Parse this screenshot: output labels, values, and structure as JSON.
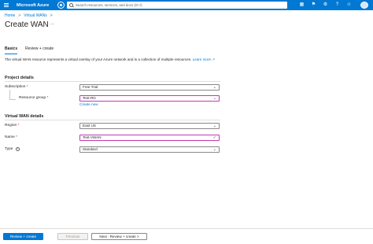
{
  "header": {
    "brand": "Microsoft Azure",
    "search_placeholder": "Search resources, services, and docs (G+/)",
    "icons": [
      "cloud-shell-icon",
      "notifications-icon",
      "settings-icon",
      "help-icon",
      "feedback-icon"
    ],
    "accent_color": "#0078d4"
  },
  "breadcrumb": {
    "items": [
      "Home",
      "Virtual WANs"
    ],
    "separator": ">"
  },
  "page": {
    "title": "Create WAN",
    "more": "..."
  },
  "tabs": [
    {
      "label": "Basics",
      "active": true
    },
    {
      "label": "Review + create",
      "active": false
    }
  ],
  "intro": {
    "text": "The virtual WAN resource represents a virtual overlay of your Azure network and is a collection of multiple resources.",
    "link_start": "Learn",
    "link_end": "more"
  },
  "project_details": {
    "title": "Project details",
    "subscription": {
      "label": "Subscription",
      "required_mark": "*",
      "value": "Free Trial"
    },
    "resource_group": {
      "label": "Resource group",
      "required_mark": "*",
      "value": "Test-RG",
      "create_new": "Create new"
    }
  },
  "wan_details": {
    "title": "Virtual WAN details",
    "region": {
      "label": "Region",
      "required_mark": "*",
      "value": "East US"
    },
    "name": {
      "label": "Name",
      "required_mark": "*",
      "value": "Test-VWAN"
    },
    "type": {
      "label": "Type",
      "info": "i",
      "value": "Standard"
    }
  },
  "footer": {
    "review_create": "Review + create",
    "previous": "Previous",
    "next": "Next : Review + create >"
  }
}
